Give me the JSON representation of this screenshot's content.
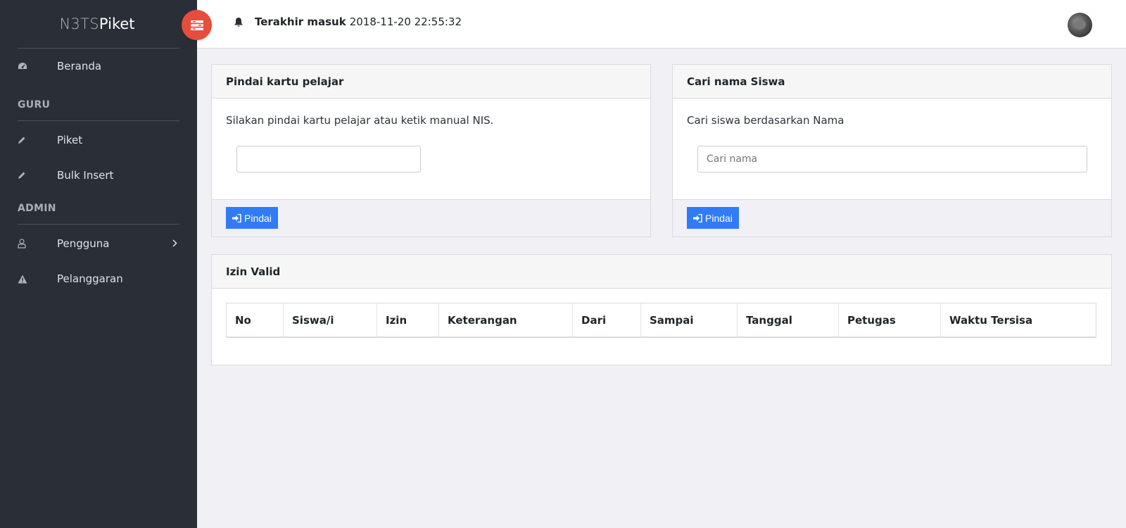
{
  "brand": {
    "part1": "N3TS",
    "part2": "Piket"
  },
  "sidebar": {
    "items": [
      {
        "label": "Beranda",
        "icon": "dashboard-icon"
      },
      {
        "label": "Piket",
        "icon": "pencil-icon"
      },
      {
        "label": "Bulk Insert",
        "icon": "pencil-icon"
      },
      {
        "label": "Pengguna",
        "icon": "user-icon"
      },
      {
        "label": "Pelanggaran",
        "icon": "warning-icon"
      }
    ],
    "sections": {
      "guru": "GURU",
      "admin": "ADMIN"
    }
  },
  "header": {
    "last_login_label": "Terakhir masuk",
    "last_login_value": "2018-11-20 22:55:32"
  },
  "scan_card": {
    "title": "Pindai kartu pelajar",
    "description": "Silakan pindai kartu pelajar atau ketik manual NIS.",
    "input_value": "",
    "input_placeholder": "",
    "button_label": "Pindai"
  },
  "search_card": {
    "title": "Cari nama Siswa",
    "description": "Cari siswa berdasarkan Nama",
    "input_placeholder": "Cari nama",
    "button_label": "Pindai"
  },
  "permit_card": {
    "title": "Izin Valid",
    "columns": [
      "No",
      "Siswa/i",
      "Izin",
      "Keterangan",
      "Dari",
      "Sampai",
      "Tanggal",
      "Petugas",
      "Waktu Tersisa"
    ],
    "rows": []
  },
  "colors": {
    "sidebar_bg": "#2a2f37",
    "toggle_bg": "#e74c3c",
    "primary_button": "#2f7cf6",
    "page_bg": "#f0f0f5"
  }
}
